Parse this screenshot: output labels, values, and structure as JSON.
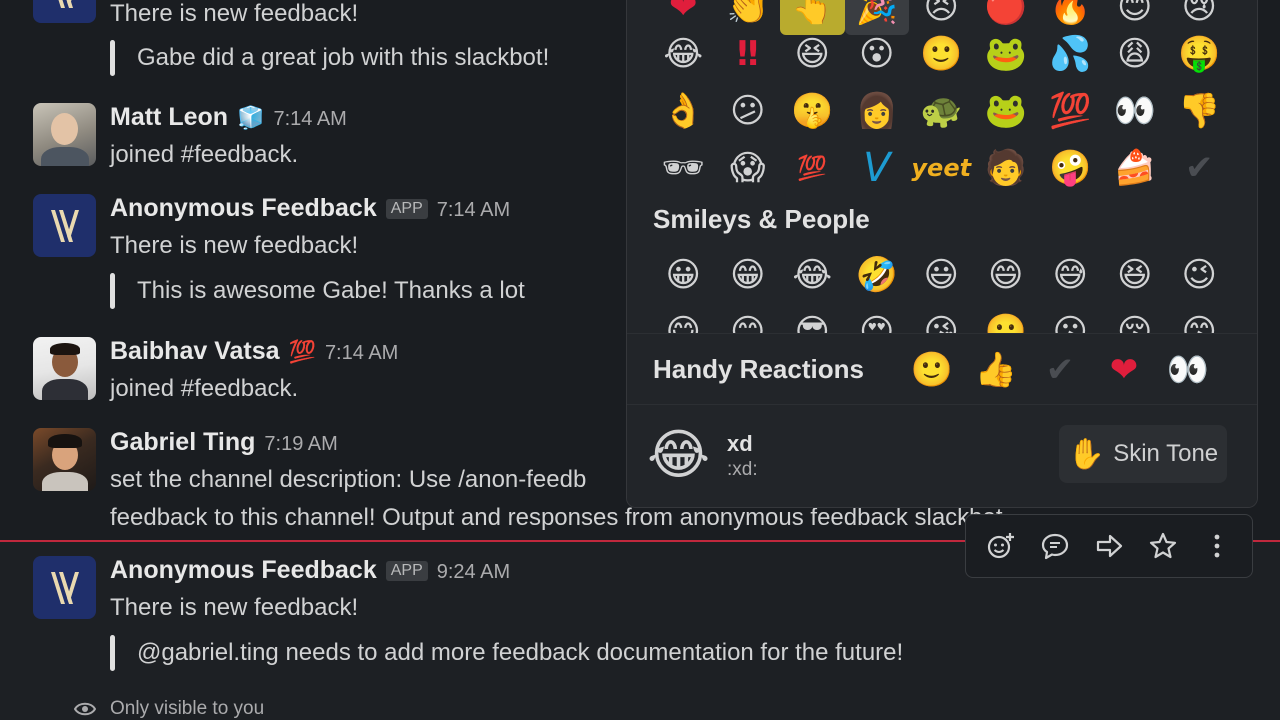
{
  "messages": [
    {
      "id": "m0",
      "text": "There is new feedback!",
      "quote": "Gabe did a great job with this slackbot!"
    },
    {
      "id": "m1",
      "name": "Matt Leon",
      "status_emoji": "🧊",
      "time": "7:14 AM",
      "text": "joined #feedback."
    },
    {
      "id": "m2",
      "name": "Anonymous Feedback",
      "badge": "APP",
      "time": "7:14 AM",
      "text": "There is new feedback!",
      "quote": "This is awesome Gabe! Thanks a lot"
    },
    {
      "id": "m3",
      "name": "Baibhav Vatsa",
      "status_emoji": "💯",
      "time": "7:14 AM",
      "text": "joined #feedback."
    },
    {
      "id": "m4",
      "name": "Gabriel Ting",
      "time": "7:19 AM",
      "text": "set the channel description: Use /anon-feedb",
      "text2": "feedback to this channel! Output and responses from anonymous feedback slackbot"
    },
    {
      "id": "m5",
      "name": "Anonymous Feedback",
      "badge": "APP",
      "time": "9:24 AM",
      "text": "There is new feedback!",
      "quote": "@gabriel.ting needs to add more feedback documentation for the future!"
    }
  ],
  "only_visible": "Only visible to you",
  "picker": {
    "top_row": [
      "❤",
      "👏",
      "👆",
      "🎉",
      "😣",
      "🔴",
      "🔥",
      "😊",
      "😢"
    ],
    "rows": [
      [
        "😂",
        "‼",
        "😆",
        "😮",
        "🙂",
        "🐸",
        "💦",
        "😩",
        "🤑"
      ],
      [
        "👌",
        "😕",
        "🤫",
        "👩",
        "🐢",
        "🐸",
        "💯",
        "👀",
        "👎"
      ],
      [
        "🕶",
        "😱",
        "💯",
        "V",
        "yeet",
        "🧑",
        "🤪",
        "🍰",
        "✔"
      ]
    ],
    "section_title": "Smileys & People",
    "smileys": [
      "😀",
      "😁",
      "😂",
      "🤣",
      "😃",
      "😄",
      "😅",
      "😆",
      "😉"
    ],
    "smileys_partial": [
      "😋",
      "😊",
      "😎",
      "😍",
      "😘",
      "🙂",
      "😗",
      "😚",
      "😙"
    ],
    "handy_label": "Handy Reactions",
    "handy": [
      "🙂",
      "👍",
      "✔",
      "❤",
      "👀"
    ],
    "preview_emoji": "😂",
    "preview_name": "xd",
    "preview_code": ":xd:",
    "skin_icon": "✋",
    "skin_label": "Skin Tone"
  }
}
